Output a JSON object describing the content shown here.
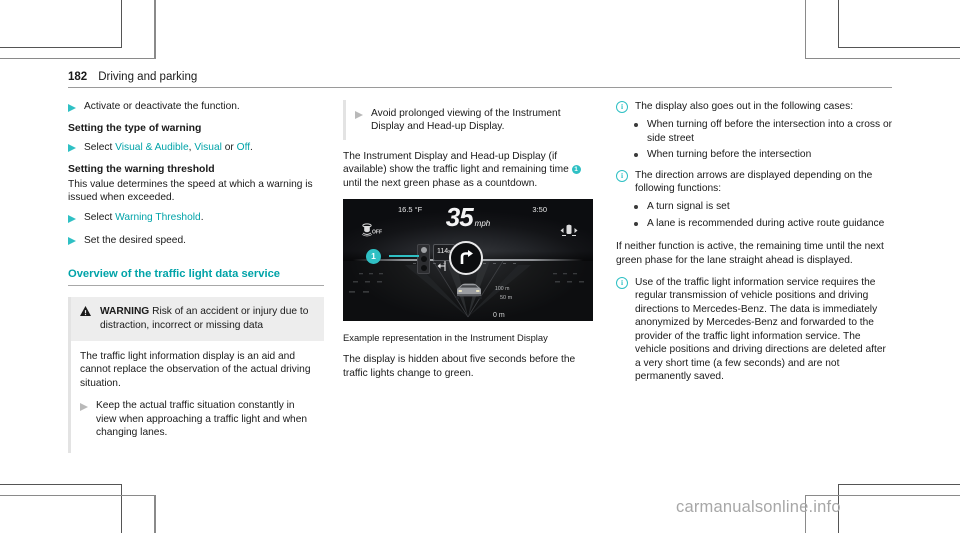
{
  "header": {
    "page_number": "182",
    "section": "Driving and parking"
  },
  "column1": {
    "step_activate": "Activate or deactivate the function.",
    "heading_type_of_warning": "Setting the type of warning",
    "select_prefix": "Select",
    "option_visual_audible": "Visual & Audible",
    "option_visual": "Visual",
    "option_or": "or",
    "option_off": "Off",
    "option_period": ".",
    "heading_warning_threshold": "Setting the warning threshold",
    "threshold_body": "This value determines the speed at which a warning is issued when exceeded.",
    "step_select_threshold_prefix": "Select",
    "step_select_threshold_link": "Warning Threshold",
    "step_select_threshold_suffix": ".",
    "step_set_speed": "Set the desired speed.",
    "section_heading": "Overview of the traffic light data service",
    "warning_label": "WARNING",
    "warning_title": "Risk of an accident or injury due to distraction, incorrect or missing data",
    "warning_body": "The traffic light information display is an aid and cannot replace the observation of the actual driving situation.",
    "warning_step": "Keep the actual traffic situation constantly in view when approaching a traffic light and when changing lanes."
  },
  "column2": {
    "step_avoid": "Avoid prolonged viewing of the Instrument Display and Head-up Display.",
    "body_part1": "The Instrument Display and Head-up Display (if available) show the traffic light and remaining time",
    "marker_number": "1",
    "body_part2": "until the next green phase as a countdown.",
    "caption": "Example representation in the Instrument Display",
    "body_hidden": "The display is hidden about five seconds before the traffic lights change to green.",
    "instrument_display": {
      "temperature": "16.5 °F",
      "clock": "3:50",
      "speed": "35",
      "speed_unit": "mph",
      "esp_icon_label": "OFF",
      "countdown": "114",
      "countdown_unit": "s",
      "distance_100": "100 m",
      "distance_50": "50 m",
      "distance_0": "0 m",
      "callout_number": "1"
    }
  },
  "column3": {
    "note1": "The display also goes out in the following cases:",
    "note1_bullets": [
      "When turning off before the intersection into a cross or side street",
      "When turning before the intersection"
    ],
    "note2": "The direction arrows are displayed depending on the following functions:",
    "note2_bullets": [
      "A turn signal is set",
      "A lane is recommended during active route guidance"
    ],
    "body_neither": "If neither function is active, the remaining time until the next green phase for the lane straight ahead is displayed.",
    "note3": "Use of the traffic light information service requires the regular transmission of vehicle positions and driving directions to Mercedes-Benz. The data is immediately anonymized by Mercedes-Benz and forwarded to the provider of the traffic light information service. The vehicle positions and driving directions are deleted after a very short time (a few seconds) and are not permanently saved."
  },
  "watermark": "carmanualsonline.info",
  "colors": {
    "accent_teal": "#00a3a8",
    "marker_teal": "#2fc0c4",
    "warning_bg": "#ededed",
    "rule_gray": "#9a9a9a"
  }
}
